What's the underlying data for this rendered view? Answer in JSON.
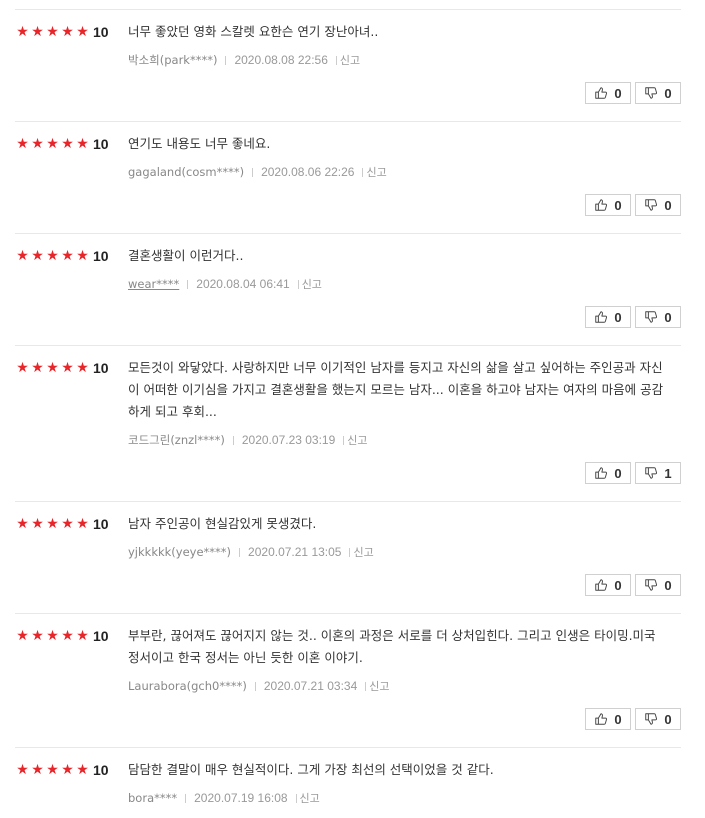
{
  "reviews": [
    {
      "rating": "10",
      "text": "너무 좋았던 영화 스칼렛 요한슨 연기 장난아녀..",
      "user": "박소희(park****)",
      "date": "2020.08.08 22:56",
      "report": "신고",
      "likes": "0",
      "dislikes": "0"
    },
    {
      "rating": "10",
      "text": "연기도 내용도 너무 좋네요.",
      "user": "gagaland(cosm****)",
      "date": "2020.08.06 22:26",
      "report": "신고",
      "likes": "0",
      "dislikes": "0"
    },
    {
      "rating": "10",
      "text": "결혼생활이 이런거다..",
      "user": "wear****",
      "date": "2020.08.04 06:41",
      "report": "신고",
      "likes": "0",
      "dislikes": "0"
    },
    {
      "rating": "10",
      "text": "모든것이 와닿았다. 사랑하지만 너무 이기적인 남자를 등지고 자신의 삶을 살고 싶어하는 주인공과 자신이 어떠한 이기심을 가지고 결혼생활을 했는지 모르는 남자... 이혼을 하고야 남자는 여자의 마음에 공감하게 되고 후회...",
      "user": "코드그린(znzl****)",
      "date": "2020.07.23 03:19",
      "report": "신고",
      "likes": "0",
      "dislikes": "1"
    },
    {
      "rating": "10",
      "text": "남자 주인공이 현실감있게 못생겼다.",
      "user": "yjkkkkk(yeye****)",
      "date": "2020.07.21 13:05",
      "report": "신고",
      "likes": "0",
      "dislikes": "0"
    },
    {
      "rating": "10",
      "text": "부부란, 끊어져도 끊어지지 않는 것.. 이혼의 과정은 서로를 더 상처입힌다. 그리고 인생은 타이밍.미국 정서이고 한국 정서는 아닌 듯한 이혼 이야기.",
      "user": "Laurabora(gch0****)",
      "date": "2020.07.21 03:34",
      "report": "신고",
      "likes": "0",
      "dislikes": "0"
    },
    {
      "rating": "10",
      "text": "담담한 결말이 매우 현실적이다. 그게 가장 최선의 선택이었을 것 같다.",
      "user": "bora****",
      "date": "2020.07.19 16:08",
      "report": "신고"
    }
  ],
  "colors": {
    "star": "#e8262a",
    "border": "#d0d0d0",
    "separator": "#e8e8e8"
  },
  "icons": {
    "like": "thumbs-up-icon",
    "dislike": "thumbs-down-icon",
    "star": "star-icon"
  }
}
